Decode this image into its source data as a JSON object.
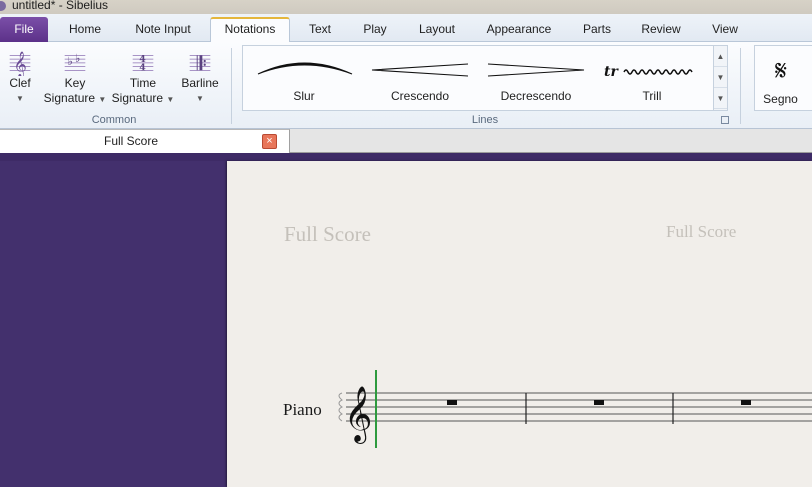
{
  "window": {
    "title": "untitled* - Sibelius"
  },
  "ribbon_tabs": {
    "file": "File",
    "tabs": [
      {
        "label": "Home"
      },
      {
        "label": "Note Input"
      },
      {
        "label": "Notations"
      },
      {
        "label": "Text"
      },
      {
        "label": "Play"
      },
      {
        "label": "Layout"
      },
      {
        "label": "Appearance"
      },
      {
        "label": "Parts"
      },
      {
        "label": "Review"
      },
      {
        "label": "View"
      }
    ],
    "active": "Notations"
  },
  "ribbon": {
    "common": {
      "group_label": "Common",
      "clef": {
        "line1": "Clef",
        "icon": "treble-clef-icon"
      },
      "key_signature": {
        "line1": "Key",
        "line2": "Signature",
        "icon": "key-signature-icon"
      },
      "time_signature": {
        "line1": "Time",
        "line2": "Signature",
        "icon": "time-signature-icon"
      },
      "barline": {
        "line1": "Barline",
        "icon": "barline-icon"
      }
    },
    "lines": {
      "group_label": "Lines",
      "items": [
        {
          "label": "Slur",
          "icon": "slur-icon"
        },
        {
          "label": "Crescendo",
          "icon": "crescendo-icon"
        },
        {
          "label": "Decrescendo",
          "icon": "decrescendo-icon"
        },
        {
          "label": "Trill",
          "icon": "trill-icon",
          "glyph": "tr"
        }
      ]
    },
    "segno": {
      "label": "Segno",
      "icon": "segno-icon"
    }
  },
  "document_tab": {
    "label": "Full Score",
    "close": "×"
  },
  "score": {
    "header_left": "Full Score",
    "header_right": "Full Score",
    "instrument": "Piano"
  },
  "colors": {
    "accent_purple": "#5c3189",
    "background_purple": "#43306d",
    "paper": "#f1eeea",
    "selection_green": "#2e9a3e"
  }
}
